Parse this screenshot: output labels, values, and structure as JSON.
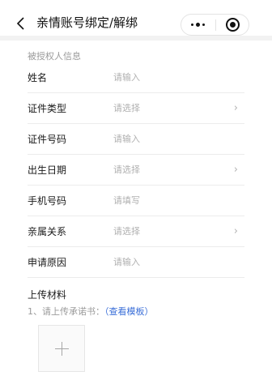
{
  "navbar": {
    "title": "亲情账号绑定/解绑",
    "icons": {
      "back": "chevron-left-icon",
      "more": "more-dots-icon",
      "close": "target-circle-icon"
    }
  },
  "section": {
    "header": "被授权人信息"
  },
  "form": {
    "rows": [
      {
        "label": "姓名",
        "value": "请输入",
        "has_chevron": false
      },
      {
        "label": "证件类型",
        "value": "请选择",
        "has_chevron": true
      },
      {
        "label": "证件号码",
        "value": "请输入",
        "has_chevron": false
      },
      {
        "label": "出生日期",
        "value": "请选择",
        "has_chevron": true
      },
      {
        "label": "手机号码",
        "value": "请填写",
        "has_chevron": false
      },
      {
        "label": "亲属关系",
        "value": "请选择",
        "has_chevron": true
      },
      {
        "label": "申请原因",
        "value": "请输入",
        "has_chevron": false
      }
    ],
    "chevron": "›"
  },
  "upload": {
    "title": "上传材料",
    "hint_prefix": "1、请上传承诺书：",
    "template_link": "（查看模板）",
    "icon": "plus-icon"
  },
  "colors": {
    "link": "#3b6fd8",
    "placeholder": "#b0b0b0",
    "section_label": "#9a9a9a"
  }
}
